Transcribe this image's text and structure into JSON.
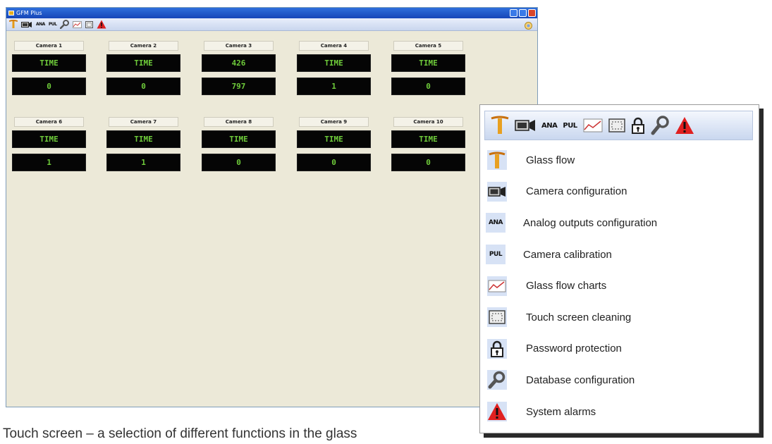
{
  "window": {
    "title": "GFM Plus"
  },
  "toolbar": {
    "icons": [
      "glass-flow-icon",
      "camera-config-icon",
      "analog-outputs-icon",
      "camera-calibration-icon",
      "database-config-icon",
      "glass-flow-charts-icon",
      "touch-screen-cleaning-icon",
      "system-alarms-icon"
    ],
    "right_icon": "display-settings-icon",
    "text_icons": {
      "analog": "ANA",
      "pul": "PUL"
    }
  },
  "cameras_row1": [
    {
      "label": "Camera 1",
      "top": "TIME",
      "bottom": "0"
    },
    {
      "label": "Camera 2",
      "top": "TIME",
      "bottom": "0"
    },
    {
      "label": "Camera 3",
      "top": "426",
      "bottom": "797"
    },
    {
      "label": "Camera 4",
      "top": "TIME",
      "bottom": "1"
    },
    {
      "label": "Camera 5",
      "top": "TIME",
      "bottom": "0"
    }
  ],
  "cameras_row2": [
    {
      "label": "Camera 6",
      "top": "TIME",
      "bottom": "1"
    },
    {
      "label": "Camera 7",
      "top": "TIME",
      "bottom": "1"
    },
    {
      "label": "Camera 8",
      "top": "TIME",
      "bottom": "0"
    },
    {
      "label": "Camera 9",
      "top": "TIME",
      "bottom": "0"
    },
    {
      "label": "Camera 10",
      "top": "TIME",
      "bottom": "0"
    }
  ],
  "legend": {
    "items": [
      {
        "icon": "glass-flow-icon",
        "label": "Glass flow"
      },
      {
        "icon": "camera-config-icon",
        "label": "Camera configuration"
      },
      {
        "icon": "analog-outputs-icon",
        "label": "Analog outputs configuration"
      },
      {
        "icon": "camera-calibration-icon",
        "label": "Camera calibration"
      },
      {
        "icon": "glass-flow-charts-icon",
        "label": "Glass flow charts"
      },
      {
        "icon": "touch-screen-cleaning-icon",
        "label": "Touch screen cleaning"
      },
      {
        "icon": "password-lock-icon",
        "label": "Password protection"
      },
      {
        "icon": "database-config-icon",
        "label": "Database configuration"
      },
      {
        "icon": "system-alarms-icon",
        "label": "System alarms"
      }
    ]
  },
  "caption": "Touch screen – a selection of different functions in the glass",
  "colors": {
    "title_bar": "#1f56c8",
    "value_text": "#6ecb3a",
    "panel_bg": "#ece9d8",
    "alarm": "#e02020"
  }
}
